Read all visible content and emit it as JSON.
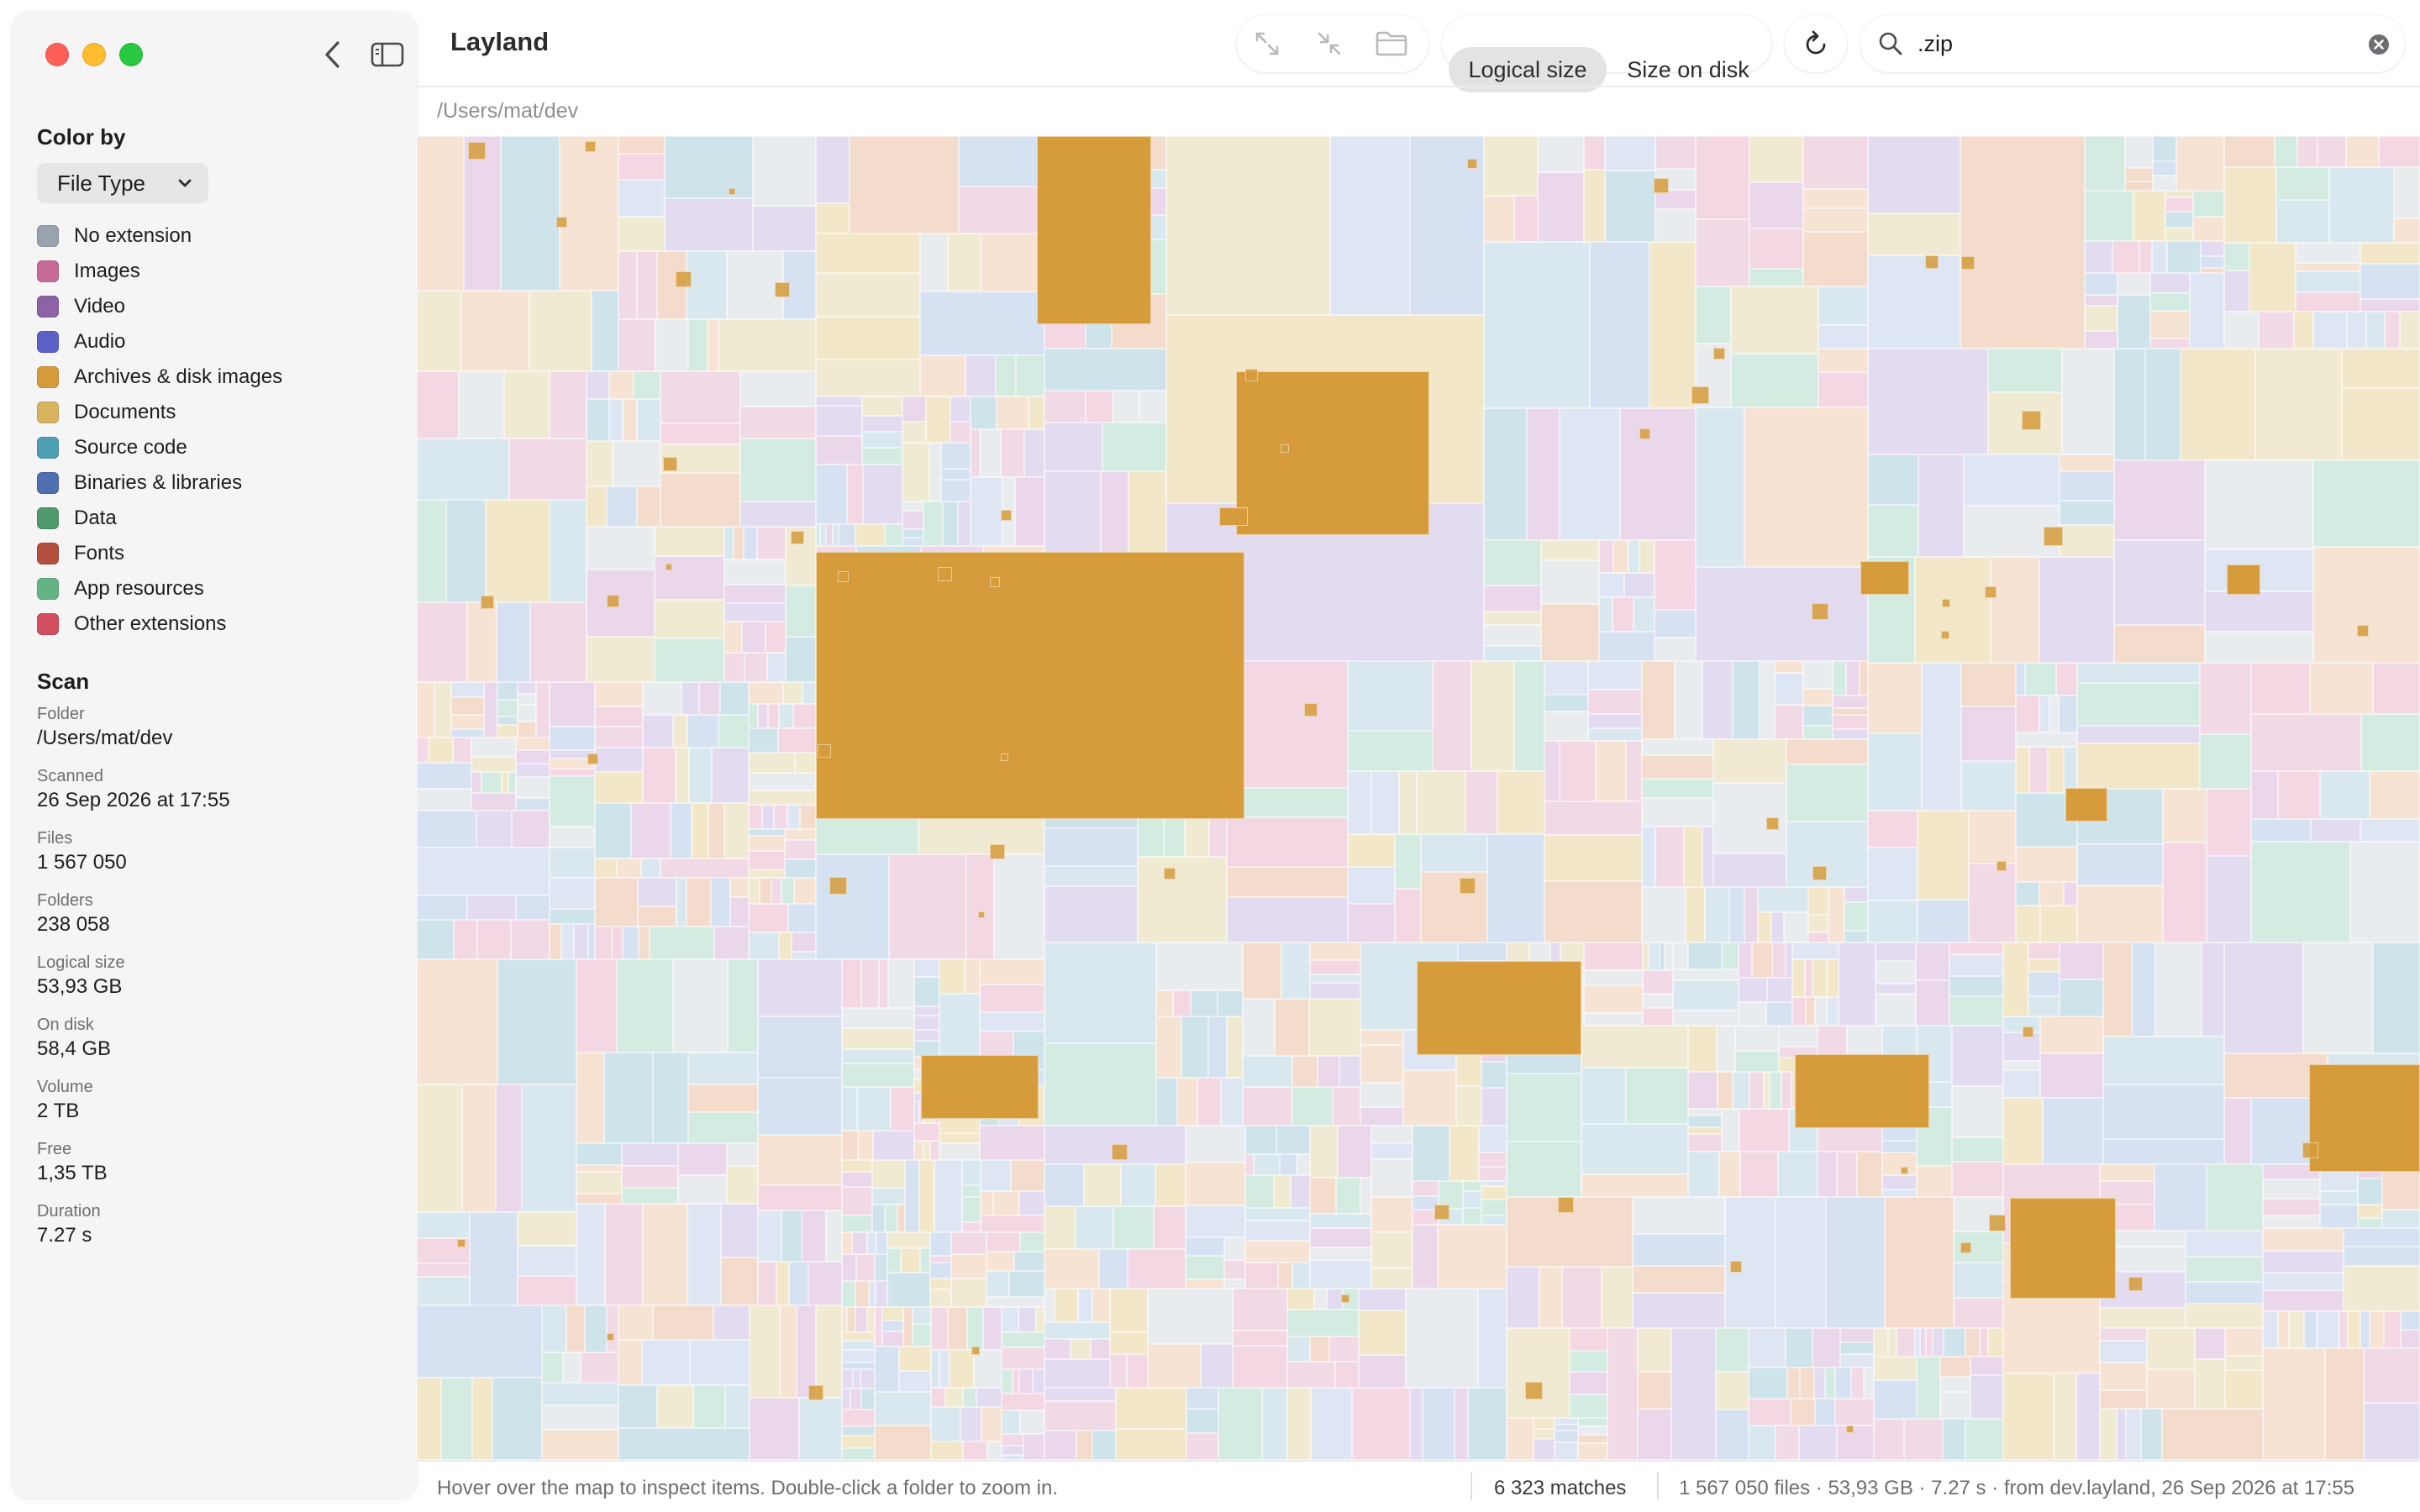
{
  "app": {
    "title": "Layland"
  },
  "sidebar": {
    "color_by_title": "Color by",
    "color_by_selected": "File Type",
    "legend": [
      {
        "label": "No extension",
        "color": "#9aa3ad"
      },
      {
        "label": "Images",
        "color": "#c66b98"
      },
      {
        "label": "Video",
        "color": "#8d63a6"
      },
      {
        "label": "Audio",
        "color": "#5b62c7"
      },
      {
        "label": "Archives & disk images",
        "color": "#d69c3c"
      },
      {
        "label": "Documents",
        "color": "#d8b45e"
      },
      {
        "label": "Source code",
        "color": "#4e9fb4"
      },
      {
        "label": "Binaries & libraries",
        "color": "#4f6fb0"
      },
      {
        "label": "Data",
        "color": "#4e9a6c"
      },
      {
        "label": "Fonts",
        "color": "#b24f3f"
      },
      {
        "label": "App resources",
        "color": "#64b384"
      },
      {
        "label": "Other extensions",
        "color": "#d24f5f"
      }
    ],
    "scan_title": "Scan",
    "scan": [
      {
        "key": "Folder",
        "value": "/Users/mat/dev"
      },
      {
        "key": "Scanned",
        "value": "26 Sep 2026 at 17:55"
      },
      {
        "key": "Files",
        "value": "1 567 050"
      },
      {
        "key": "Folders",
        "value": "238 058"
      },
      {
        "key": "Logical size",
        "value": "53,93 GB"
      },
      {
        "key": "On disk",
        "value": "58,4 GB"
      },
      {
        "key": "Volume",
        "value": "2 TB"
      },
      {
        "key": "Free",
        "value": "1,35 TB"
      },
      {
        "key": "Duration",
        "value": "7.27 s"
      }
    ]
  },
  "toolbar": {
    "size_modes": [
      "Logical size",
      "Size on disk"
    ],
    "selected_mode": "Logical size",
    "icons": [
      "expand-icon",
      "collapse-icon",
      "folder-icon",
      "refresh-icon",
      "search-icon",
      "clear-icon"
    ],
    "search_value": ".zip",
    "search_placeholder": "Search"
  },
  "breadcrumb": "/Users/mat/dev",
  "status": {
    "hint": "Hover over the map to inspect items. Double-click a folder to zoom in.",
    "matches": "6 323 matches",
    "summary": "1 567 050 files · 53,93 GB · 7.27 s · from dev.layland, 26 Sep 2026 at 17:55"
  },
  "colors": {
    "accent_match": "#d69c3c",
    "sidebar_bg": "#f5f5f6"
  }
}
